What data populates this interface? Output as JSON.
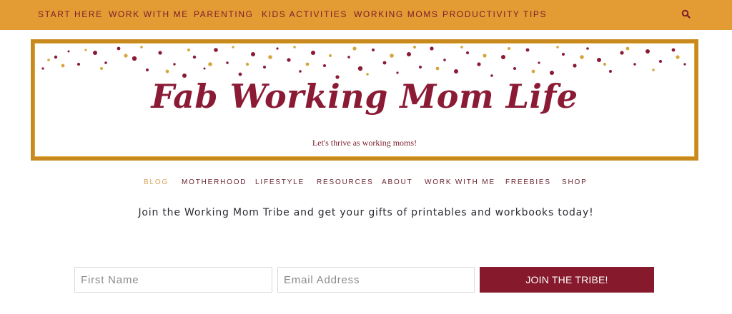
{
  "top_nav": {
    "items": [
      {
        "label": "START HERE"
      },
      {
        "label": "WORK WITH ME"
      },
      {
        "label": "PARENTING"
      },
      {
        "label": "KIDS ACTIVITIES"
      },
      {
        "label": "WORKING MOMS"
      },
      {
        "label": "PRODUCTIVITY TIPS"
      }
    ],
    "search_icon": "search-icon",
    "background": "#e39c34",
    "text_color": "#7a1d2a"
  },
  "banner": {
    "title": "Fab Working Mom Life",
    "tagline": "Let's thrive as working moms!",
    "title_color": "#8b1a35",
    "frame_color": "#c8891f"
  },
  "sub_nav": {
    "items": [
      {
        "label": "BLOG",
        "active": true
      },
      {
        "label": "MOTHERHOOD"
      },
      {
        "label": "LIFESTYLE"
      },
      {
        "label": "RESOURCES"
      },
      {
        "label": "ABOUT"
      },
      {
        "label": "WORK WITH ME"
      },
      {
        "label": "FREEBIES"
      },
      {
        "label": "SHOP"
      }
    ]
  },
  "promo": {
    "text": "Join the Working Mom Tribe and get your gifts of printables and workbooks today!"
  },
  "signup_form": {
    "first_name_placeholder": "First Name",
    "first_name_value": "",
    "email_placeholder": "Email Address",
    "email_value": "",
    "submit_label": "JOIN THE TRIBE!",
    "submit_color": "#861a2c"
  }
}
